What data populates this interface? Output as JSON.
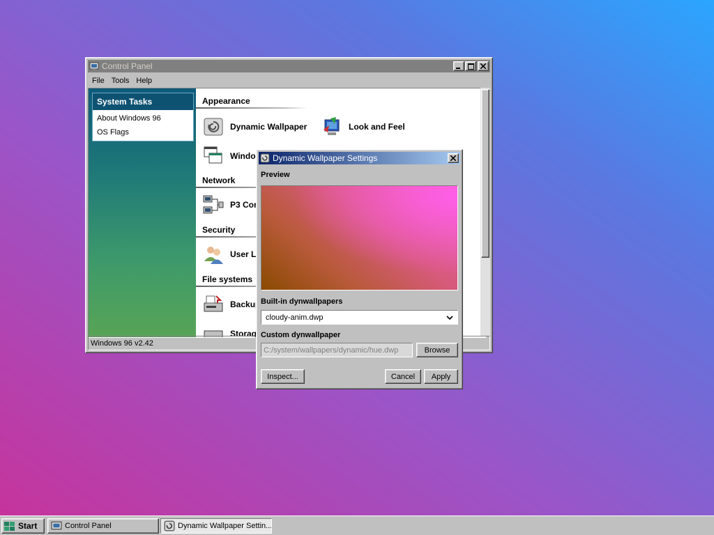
{
  "control_panel": {
    "title": "Control Panel",
    "menu": [
      "File",
      "Tools",
      "Help"
    ],
    "sidebar": {
      "header": "System Tasks",
      "items": [
        "About Windows 96",
        "OS Flags"
      ]
    },
    "sections": {
      "appearance": "Appearance",
      "network": "Network",
      "security": "Security",
      "file_systems": "File systems"
    },
    "items": {
      "dynamic_wallpaper": "Dynamic Wallpaper",
      "look_and_feel": "Look and Feel",
      "window": "Windo",
      "p3": "P3 Cor",
      "user": "User L",
      "backup": "Backup",
      "storage": "Storag"
    },
    "status": "Windows 96 v2.42"
  },
  "dialog": {
    "title": "Dynamic Wallpaper Settings",
    "preview_label": "Preview",
    "builtin_label": "Built-in dynwallpapers",
    "builtin_value": "cloudy-anim.dwp",
    "custom_label": "Custom dynwallpaper",
    "custom_value": "C:/system/wallpapers/dynamic/hue.dwp",
    "browse": "Browse",
    "inspect": "Inspect...",
    "cancel": "Cancel",
    "apply": "Apply"
  },
  "taskbar": {
    "start": "Start",
    "tasks": [
      "Control Panel",
      "Dynamic Wallpaper Settin..."
    ]
  },
  "colors": {
    "titlebar_active": "#0a246a",
    "titlebar_inactive": "#808080",
    "sidebar_header": "#0e5272",
    "window_face": "#c0c0c0"
  }
}
